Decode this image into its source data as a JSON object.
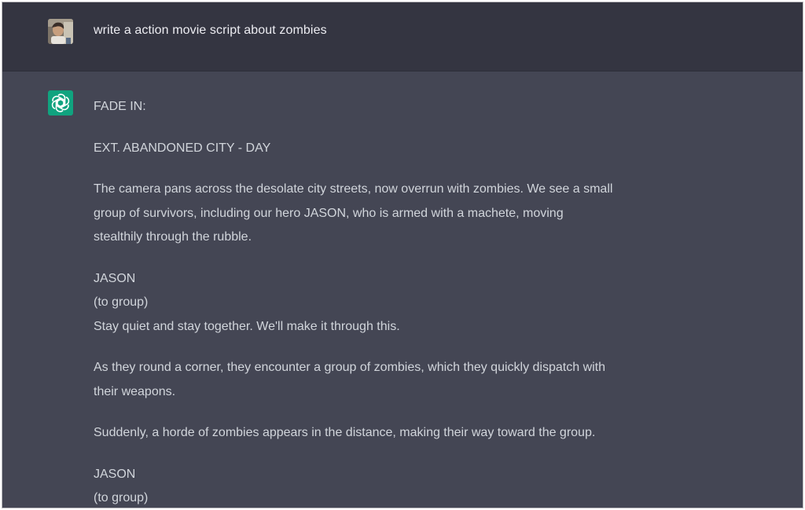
{
  "conversation": {
    "user": {
      "avatar_icon": "user-photo-avatar",
      "message": "write a action movie script about zombies"
    },
    "assistant": {
      "icon": "openai-logo-icon",
      "brand_color": "#10a37f",
      "paragraphs": [
        {
          "lines": [
            "FADE IN:"
          ]
        },
        {
          "lines": [
            "EXT. ABANDONED CITY - DAY"
          ]
        },
        {
          "lines": [
            "The camera pans across the desolate city streets, now overrun with zombies. We see a small",
            "group of survivors, including our hero JASON, who is armed with a machete, moving",
            "stealthily through the rubble."
          ]
        },
        {
          "lines": [
            "JASON",
            "(to group)",
            "Stay quiet and stay together. We'll make it through this."
          ]
        },
        {
          "lines": [
            "As they round a corner, they encounter a group of zombies, which they quickly dispatch with",
            "their weapons."
          ]
        },
        {
          "lines": [
            "Suddenly, a horde of zombies appears in the distance, making their way toward the group."
          ]
        },
        {
          "lines": [
            "JASON",
            "(to group)"
          ]
        }
      ]
    }
  },
  "colors": {
    "user_row_bg": "#343541",
    "assistant_row_bg": "#444654",
    "text": "#d1d5db"
  }
}
